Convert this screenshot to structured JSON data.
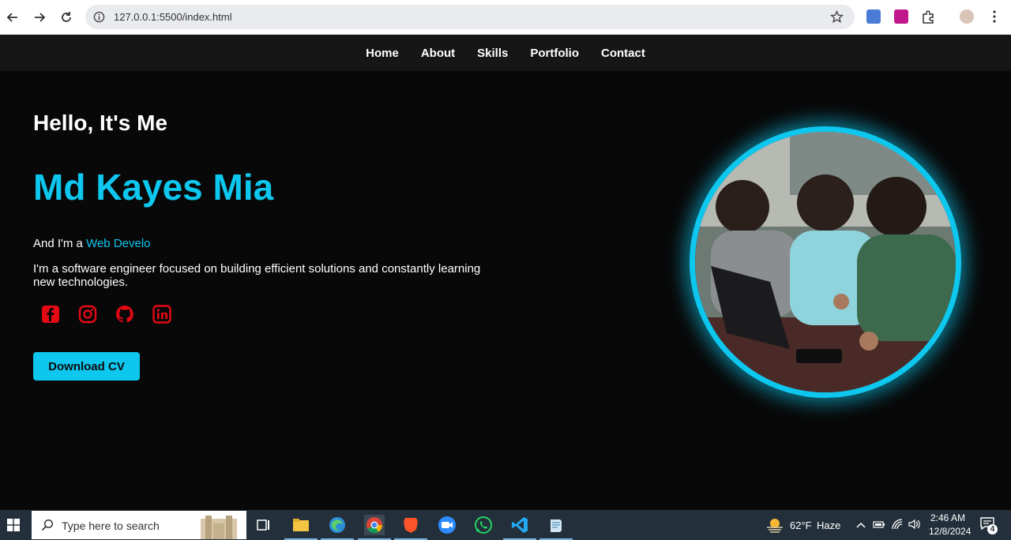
{
  "browser": {
    "url": "127.0.0.1:5500/index.html"
  },
  "nav": {
    "items": [
      "Home",
      "About",
      "Skills",
      "Portfolio",
      "Contact"
    ]
  },
  "hero": {
    "greeting": "Hello, It's Me",
    "name": "Md Kayes Mia",
    "role_prefix": "And I'm a",
    "role_typed": "Web Develo",
    "bio": "I'm a software engineer focused on building efficient solutions and constantly learning new technologies.",
    "socials": [
      "facebook-icon",
      "instagram-icon",
      "github-icon",
      "linkedin-icon"
    ],
    "social_color": "#e50914",
    "cta": "Download CV",
    "accent": "#0ec7ef"
  },
  "taskbar": {
    "search_placeholder": "Type here to search",
    "weather_temp": "62°F",
    "weather_desc": "Haze",
    "time": "2:46 AM",
    "date": "12/8/2024",
    "notifications": "4"
  }
}
